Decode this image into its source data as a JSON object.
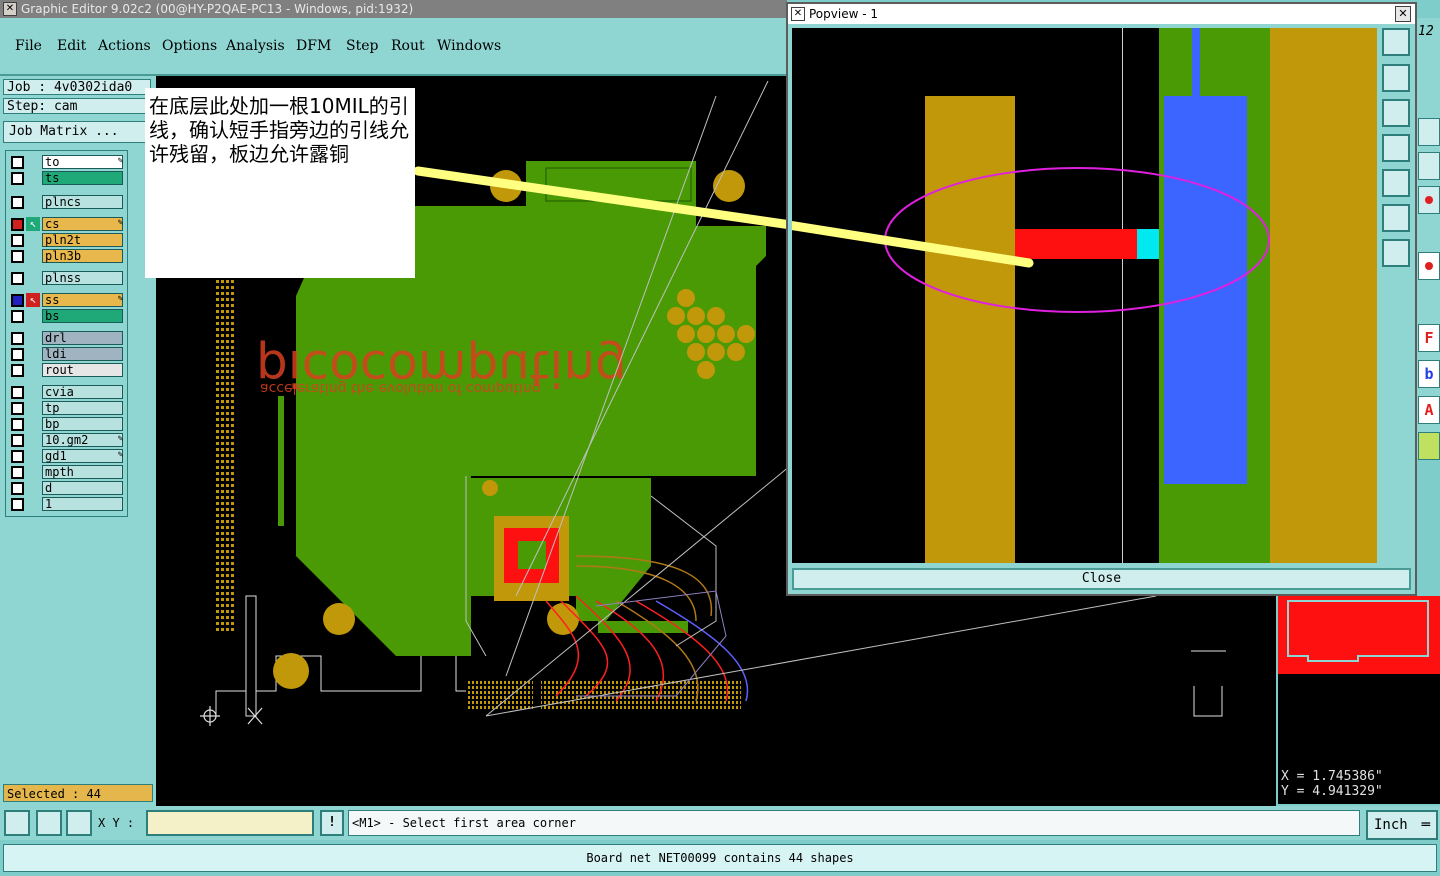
{
  "window": {
    "title": "Graphic Editor 9.02c2 (00@HY-P2QAE-PC13 - Windows, pid:1932)"
  },
  "menu": [
    "File",
    "Edit",
    "Actions",
    "Options",
    "Analysis",
    "DFM",
    "Step",
    "Rout",
    "Windows"
  ],
  "job": {
    "job_label": "Job : 4v0302ida0",
    "step_label": "Step: cam",
    "matrix_button": "Job Matrix ..."
  },
  "layers": [
    {
      "name": "to",
      "color": "#ffffff",
      "edit": true
    },
    {
      "name": "ts",
      "color": "#1fa878",
      "edit": false
    },
    {
      "name": "plncs",
      "color": "#b8e2e0",
      "edit": false
    },
    {
      "name": "cs",
      "color": "#e8b84c",
      "edit": true,
      "work": true
    },
    {
      "name": "pln2t",
      "color": "#e8b84c",
      "edit": false
    },
    {
      "name": "pln3b",
      "color": "#e8b84c",
      "edit": false
    },
    {
      "name": "plnss",
      "color": "#b8e2e0",
      "edit": false
    },
    {
      "name": "ss",
      "color": "#e8b84c",
      "edit": true,
      "work": true
    },
    {
      "name": "bs",
      "color": "#1fa878",
      "edit": false
    },
    {
      "name": "drl",
      "color": "#9fb4c0",
      "edit": false
    },
    {
      "name": "ldi",
      "color": "#9fb4c0",
      "edit": false
    },
    {
      "name": "rout",
      "color": "#e6e6e6",
      "edit": false
    },
    {
      "name": "cvia",
      "color": "#b8e2e0",
      "edit": false
    },
    {
      "name": "tp",
      "color": "#b8e2e0",
      "edit": false
    },
    {
      "name": "bp",
      "color": "#b8e2e0",
      "edit": false
    },
    {
      "name": "10.gm2",
      "color": "#b8e2e0",
      "edit": true
    },
    {
      "name": "gd1",
      "color": "#b8e2e0",
      "edit": true
    },
    {
      "name": "mpth",
      "color": "#b8e2e0",
      "edit": false
    },
    {
      "name": "d",
      "color": "#b8e2e0",
      "edit": false
    },
    {
      "name": "1",
      "color": "#b8e2e0",
      "edit": false
    }
  ],
  "selected": "Selected : 44",
  "note": {
    "text": "在底层此处加一根10MIL的引线，确认短手指旁边的引线允许残留，板边允许露铜"
  },
  "board": {
    "logo_text": "picocomputing",
    "logo_tagline": "accelerating the evolution of computing"
  },
  "popview": {
    "title": "Popview - 1",
    "close_label": "Close"
  },
  "statusbar": {
    "xy_label": "X Y :",
    "xy_value": "",
    "prompt": "<M1> - Select first area corner",
    "unit": "Inch"
  },
  "coords": {
    "x": "X = 1.745386\"",
    "y": "Y = 4.941329\""
  },
  "message": "Board net NET00099 contains 44 shapes",
  "right_strip_text": "12",
  "colors": {
    "panel": "#8fd6d2",
    "copper": "#4a9a05",
    "pad": "#c0980a",
    "highlight": "#ff1010",
    "bottom": "#3c64ff",
    "callout": "#ffff80"
  }
}
